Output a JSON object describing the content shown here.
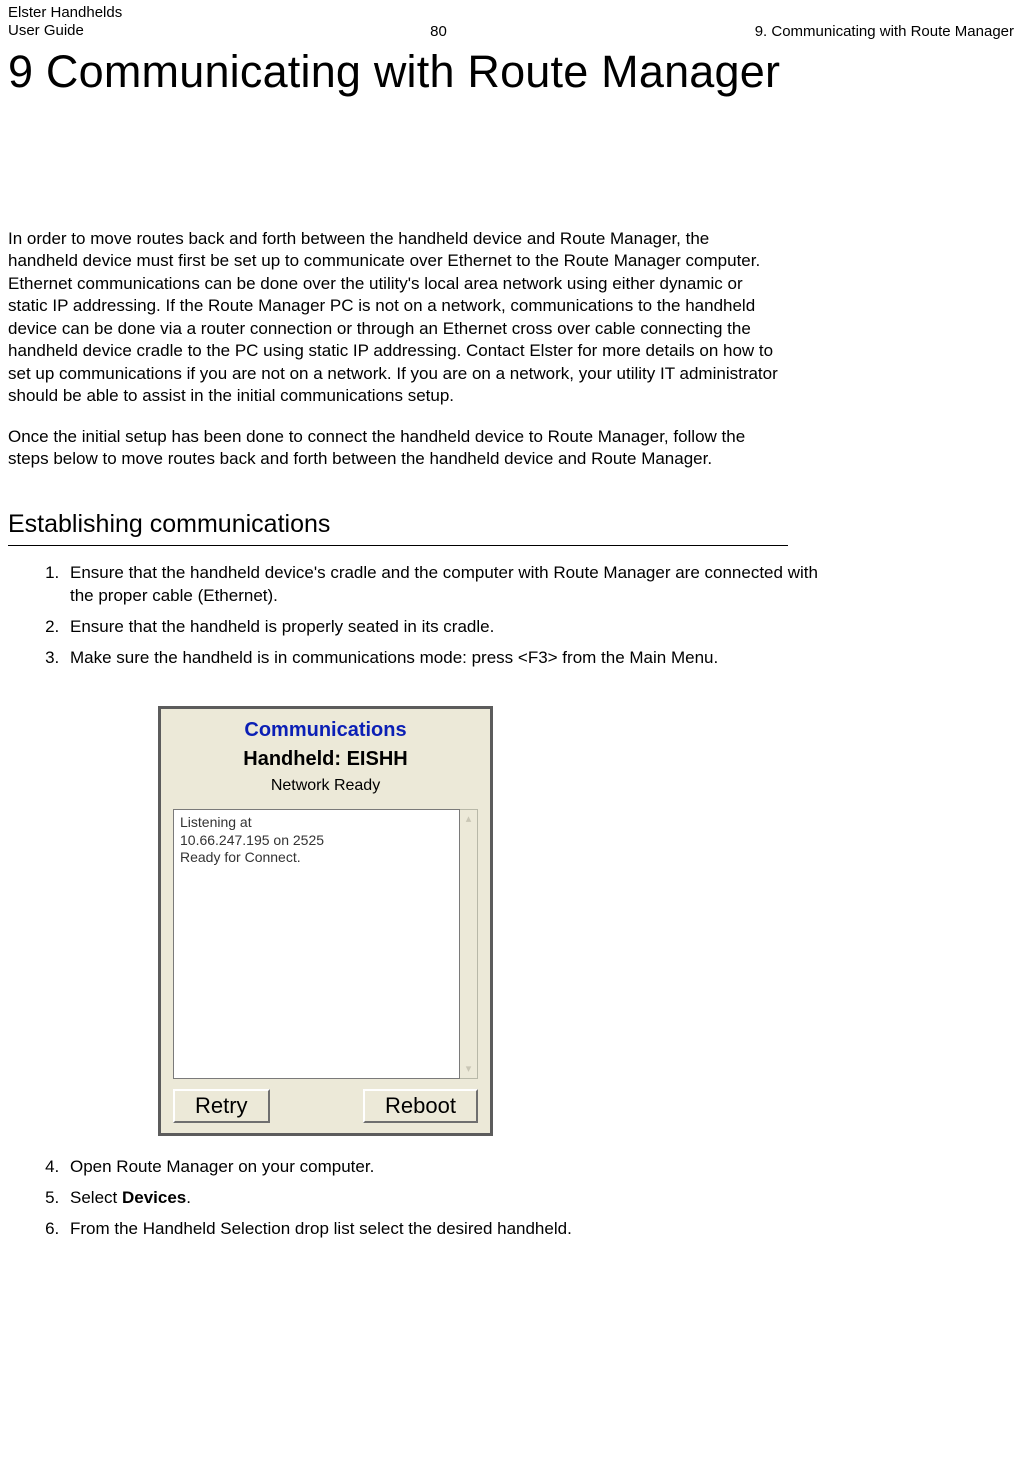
{
  "header": {
    "product": "Elster Handhelds",
    "doc": "User Guide",
    "page_number": "80",
    "section_ref": "9. Communicating with Route Manager"
  },
  "chapter_title": "9  Communicating with Route Manager",
  "intro_para_1": "In order to move routes back and forth between the handheld device and Route Manager, the handheld device must first be set up to communicate over Ethernet to the Route Manager computer. Ethernet communications can be done over the utility's local area network using either dynamic or static IP addressing. If the Route Manager PC is not on a network, communications to the handheld device can be done via a router connection or through an Ethernet cross over cable connecting the handheld device cradle to the PC using static IP addressing. Contact Elster for more details on how to set up communications if you are not on a network. If you are on a network, your utility IT administrator should be able to assist in the initial communications setup.",
  "intro_para_2": "Once the initial setup has been done to connect the handheld device to Route Manager, follow the steps below to move routes back and forth between the handheld device and Route Manager.",
  "section_heading": "Establishing communications",
  "steps": {
    "s1": "Ensure that the handheld device's cradle and the computer with Route Manager are connected with the proper cable (Ethernet).",
    "s2": "Ensure that the handheld is properly seated in its cradle.",
    "s3": "Make sure the handheld is in communications mode: press <F3> from the Main Menu.",
    "s4": "Open Route Manager on your computer.",
    "s5_prefix": "Select ",
    "s5_bold": "Devices",
    "s5_suffix": ".",
    "s6": "From the Handheld Selection drop list select the desired handheld."
  },
  "screenshot": {
    "title": "Communications",
    "handheld": "Handheld: EISHH",
    "status": "Network Ready",
    "log_text": "Listening at\n10.66.247.195 on 2525\nReady for Connect.",
    "retry_label": "Retry",
    "reboot_label": "Reboot",
    "scroll_up": "▴",
    "scroll_down": "▾"
  }
}
